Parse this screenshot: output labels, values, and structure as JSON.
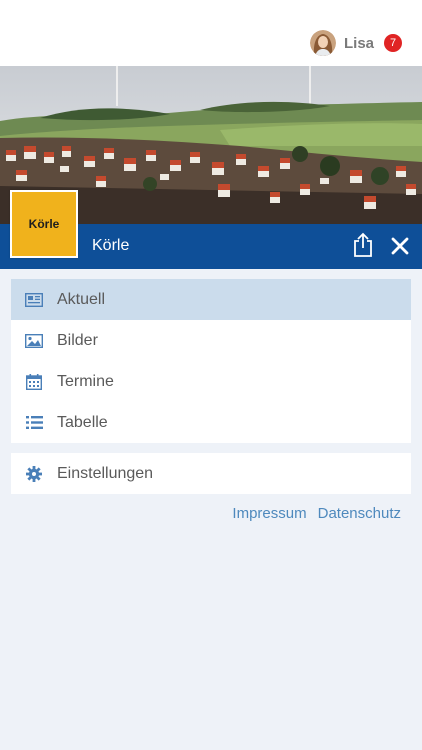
{
  "user": {
    "name": "Lisa",
    "notification_count": "7"
  },
  "club": {
    "name": "Körle",
    "logo_text": "Körle"
  },
  "menu": {
    "items": [
      {
        "label": "Aktuell",
        "icon": "newspaper-icon",
        "active": true
      },
      {
        "label": "Bilder",
        "icon": "image-icon",
        "active": false
      },
      {
        "label": "Termine",
        "icon": "calendar-icon",
        "active": false
      },
      {
        "label": "Tabelle",
        "icon": "list-icon",
        "active": false
      }
    ],
    "settings": {
      "label": "Einstellungen",
      "icon": "gear-icon"
    }
  },
  "footer": {
    "impressum": "Impressum",
    "datenschutz": "Datenschutz"
  },
  "colors": {
    "header_blue": "#0e4f98",
    "logo_yellow": "#f0b21c",
    "active_row": "#cbdcec",
    "icon_blue": "#4a7fb8",
    "link_blue": "#4e89bd",
    "badge_red": "#e02424",
    "background": "#eef2f8"
  }
}
